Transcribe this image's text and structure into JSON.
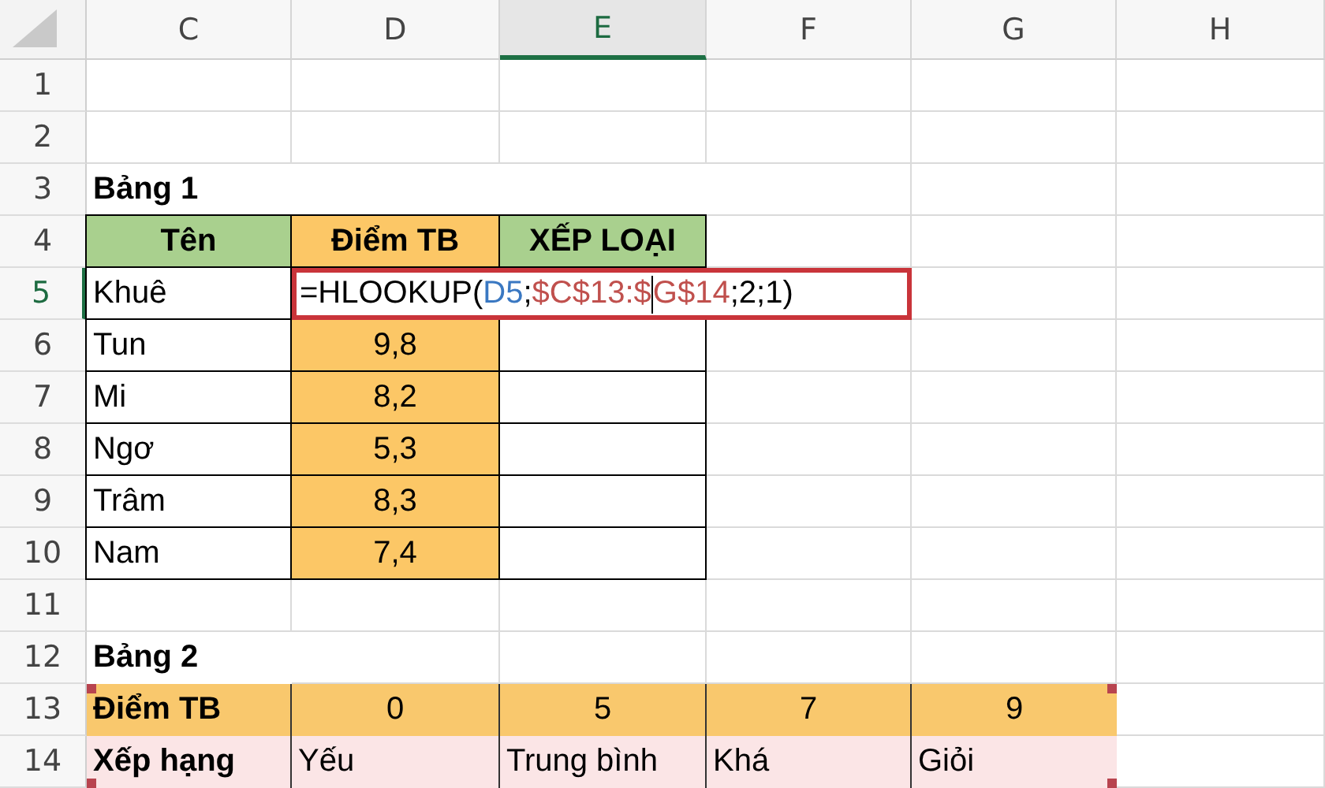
{
  "column_headers": [
    {
      "label": "C",
      "selected": false
    },
    {
      "label": "D",
      "selected": false
    },
    {
      "label": "E",
      "selected": true
    },
    {
      "label": "F",
      "selected": false
    },
    {
      "label": "G",
      "selected": false
    },
    {
      "label": "H",
      "selected": false
    }
  ],
  "row_headers": [
    {
      "label": "1",
      "selected": false
    },
    {
      "label": "2",
      "selected": false
    },
    {
      "label": "3",
      "selected": false
    },
    {
      "label": "4",
      "selected": false
    },
    {
      "label": "5",
      "selected": true
    },
    {
      "label": "6",
      "selected": false
    },
    {
      "label": "7",
      "selected": false
    },
    {
      "label": "8",
      "selected": false
    },
    {
      "label": "9",
      "selected": false
    },
    {
      "label": "10",
      "selected": false
    },
    {
      "label": "11",
      "selected": false
    },
    {
      "label": "12",
      "selected": false
    },
    {
      "label": "13",
      "selected": false
    },
    {
      "label": "14",
      "selected": false
    }
  ],
  "table_1": {
    "title": "Bảng 1",
    "header": [
      {
        "text": "Tên",
        "color": "#a9d08e"
      },
      {
        "text": "Điểm TB",
        "color": "#fcc766"
      },
      {
        "text": "XẾP LOẠI",
        "color": "#a9d08e"
      }
    ],
    "rows": [
      {
        "name": "Khuê",
        "formula": [
          {
            "kind": "text",
            "text": "=HLOOKUP(",
            "color": "#000000"
          },
          {
            "kind": "text",
            "text": "D5",
            "color": "#3a78c2"
          },
          {
            "kind": "text",
            "text": ";",
            "color": "#000000"
          },
          {
            "kind": "text",
            "text": "$C$13:$",
            "color": "#c0504d"
          },
          {
            "kind": "cursor"
          },
          {
            "kind": "text",
            "text": "G$14",
            "color": "#c0504d"
          },
          {
            "kind": "text",
            "text": ";2;1)",
            "color": "#000000"
          }
        ]
      },
      {
        "name": "Tun",
        "score": "9,8"
      },
      {
        "name": "Mi",
        "score": "8,2"
      },
      {
        "name": "Ngơ",
        "score": "5,3"
      },
      {
        "name": "Trâm",
        "score": "8,3"
      },
      {
        "name": "Nam",
        "score": "7,4"
      }
    ]
  },
  "table_2": {
    "title": "Bảng 2",
    "highlighted": true,
    "rows": [
      {
        "label": "Điểm TB",
        "kind": "score",
        "color": "#f9c86d",
        "values": [
          "0",
          "5",
          "7",
          "9"
        ]
      },
      {
        "label": "Xếp hạng",
        "kind": "rank",
        "color": "#fbe5e6",
        "values": [
          "Yếu",
          "Trung bình",
          "Khá",
          "Giỏi"
        ]
      }
    ]
  }
}
